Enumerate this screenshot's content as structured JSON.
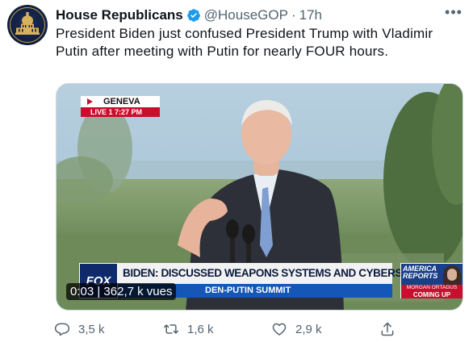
{
  "tweet": {
    "author_name": "House Republicans",
    "handle": "@HouseGOP",
    "separator": "·",
    "time": "17h",
    "more_label": "•••",
    "text": "President Biden just confused President Trump with Vladimir Putin after meeting with Putin for nearly FOUR hours."
  },
  "video": {
    "location": "GENEVA",
    "live_label": "LIVE 1 7:27 PM",
    "network": "FOX",
    "chyron": "BIDEN: DISCUSSED WEAPONS SYSTEMS AND CYBERSECURITY",
    "ticker": "DEN-PUTIN SUMMIT",
    "show_title": "AMERICA REPORTS",
    "show_guest": "MORGAN ORTAGUS",
    "show_coming": "COMING UP",
    "timer": "0:03 | 362,7 k vues"
  },
  "actions": {
    "replies": "3,5 k",
    "retweets": "1,6 k",
    "likes": "2,9 k"
  },
  "colors": {
    "text": "#0f1419",
    "muted": "#536471",
    "verified": "#1d9bf0",
    "fox_red": "#c8102e",
    "fox_blue": "#1557b7"
  }
}
